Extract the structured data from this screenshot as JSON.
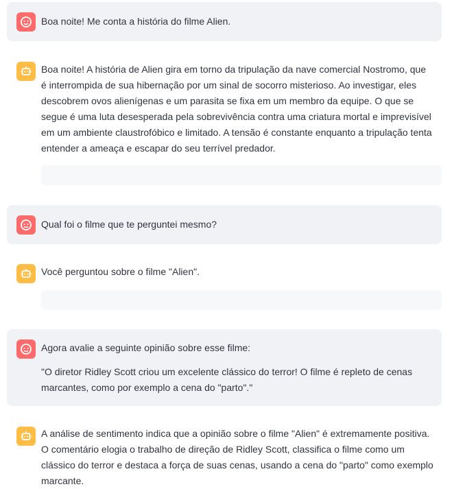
{
  "conversation": {
    "messages": [
      {
        "role": "user",
        "avatar_icon": "user-face-icon",
        "text": "Boa noite! Me conta a história do filme Alien."
      },
      {
        "role": "assistant",
        "avatar_icon": "robot-icon",
        "text": "Boa noite! A história de Alien gira em torno da tripulação da nave comercial Nostromo, que é interrompida de sua hibernação por um sinal de socorro misterioso. Ao investigar, eles descobrem ovos alienígenas e um parasita se fixa em um membro da equipe. O que se segue é uma luta desesperada pela sobrevivência contra uma criatura mortal e imprevisível em um ambiente claustrofóbico e limitado. A tensão é constante enquanto a tripulação tenta entender a ameaça e escapar do seu terrível predador."
      },
      {
        "role": "user",
        "avatar_icon": "user-face-icon",
        "text": "Qual foi o filme que te perguntei mesmo?"
      },
      {
        "role": "assistant",
        "avatar_icon": "robot-icon",
        "text": "Você perguntou sobre o filme \"Alien\"."
      },
      {
        "role": "user",
        "avatar_icon": "user-face-icon",
        "text": "Agora avalie a seguinte opinião sobre esse filme:",
        "quote": "\"O diretor Ridley Scott criou um excelente clássico do terror! O filme é repleto de cenas marcantes, como por exemplo a cena do \"parto\".\""
      },
      {
        "role": "assistant",
        "avatar_icon": "robot-icon",
        "text": "A análise de sentimento indica que a opinião sobre o filme \"Alien\" é extremamente positiva. O comentário elogia o trabalho de direção de Ridley Scott, classifica o filme como um clássico do terror e destaca a força de suas cenas, usando a cena do \"parto\" como exemplo marcante."
      }
    ]
  },
  "colors": {
    "user_avatar": "#ff6b6b",
    "bot_avatar": "#ffbd45",
    "user_bubble": "#f0f2f6",
    "text": "#31333f"
  }
}
